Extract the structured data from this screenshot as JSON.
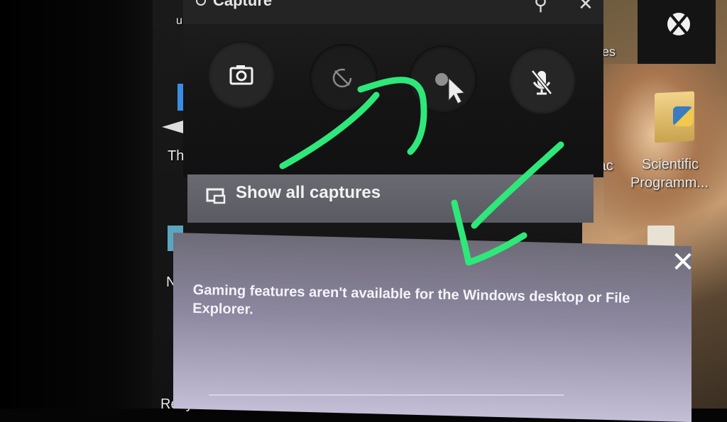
{
  "capture_widget": {
    "title": "Capture",
    "pin_icon": "pin-icon",
    "close_icon": "close-icon",
    "buttons": [
      {
        "name": "screenshot-button",
        "icon": "camera-icon"
      },
      {
        "name": "record-last-30s-button",
        "icon": "record-history-icon"
      },
      {
        "name": "start-recording-button",
        "icon": "record-dot-icon"
      },
      {
        "name": "mic-toggle-button",
        "icon": "mic-off-icon"
      }
    ],
    "show_all_captures": "Show all captures"
  },
  "notification": {
    "message": "Gaming features aren't available for the Windows desktop or File Explorer.",
    "close_icon": "close-icon"
  },
  "desktop": {
    "labels": {
      "left_this": "Thi",
      "left_n": "N",
      "left_recycle": "Recy",
      "left_u": "u",
      "mid_es": "es",
      "mid_rac": "rac",
      "folder_label_line1": "Scientific",
      "folder_label_line2": "Programm..."
    },
    "xbox_icon": "xbox-icon"
  },
  "annotation_color": "#2ee87a"
}
